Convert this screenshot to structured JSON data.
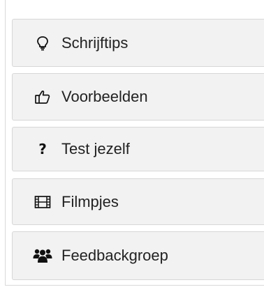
{
  "menu": {
    "items": [
      {
        "label": "Schrijftips",
        "icon": "lightbulb-icon"
      },
      {
        "label": "Voorbeelden",
        "icon": "thumbs-up-icon"
      },
      {
        "label": "Test jezelf",
        "icon": "question-icon"
      },
      {
        "label": "Filmpjes",
        "icon": "film-icon"
      },
      {
        "label": "Feedbackgroep",
        "icon": "users-icon"
      }
    ]
  },
  "colors": {
    "item_background": "#f2f2f2",
    "item_border": "#d7d7d7",
    "text": "#222222"
  }
}
